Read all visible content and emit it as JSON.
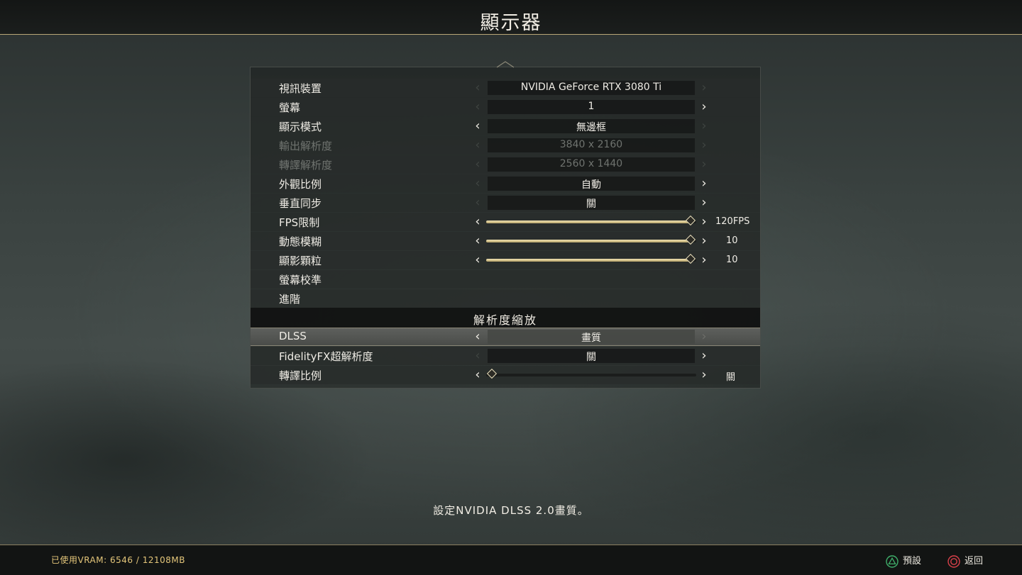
{
  "header": {
    "title": "顯示器"
  },
  "settings": {
    "video_device": {
      "label": "視訊裝置",
      "value": "NVIDIA GeForce RTX 3080 Ti"
    },
    "monitor": {
      "label": "螢幕",
      "value": "1"
    },
    "display_mode": {
      "label": "顯示模式",
      "value": "無邊框"
    },
    "output_resolution": {
      "label": "輸出解析度",
      "value": "3840 x 2160"
    },
    "render_resolution": {
      "label": "轉譯解析度",
      "value": "2560 x 1440"
    },
    "aspect_ratio": {
      "label": "外觀比例",
      "value": "自動"
    },
    "vsync": {
      "label": "垂直同步",
      "value": "關"
    },
    "fps_limit": {
      "label": "FPS限制",
      "display": "120FPS",
      "level": 1.0
    },
    "motion_blur": {
      "label": "動態模糊",
      "display": "10",
      "level": 1.0
    },
    "film_grain": {
      "label": "顯影顆粒",
      "display": "10",
      "level": 1.0
    },
    "calibration": {
      "label": "螢幕校準"
    },
    "advanced": {
      "label": "進階"
    }
  },
  "resolution_scaling": {
    "header": "解析度縮放",
    "dlss": {
      "label": "DLSS",
      "value": "畫質"
    },
    "fsr": {
      "label": "FidelityFX超解析度",
      "value": "關"
    },
    "render_scale": {
      "label": "轉譯比例",
      "display": "關",
      "level": 0.0
    }
  },
  "description": "設定NVIDIA DLSS 2.0畫質。",
  "footer": {
    "vram": "已使用VRAM: 6546 / 12108MB",
    "defaults_label": "預設",
    "back_label": "返回",
    "defaults_icon": "triangle-icon",
    "back_icon": "circle-icon",
    "triangle_color": "#3fae6a",
    "circle_color": "#d8404a"
  },
  "colors": {
    "accent": "#e4c67a",
    "slider": "#e6d7a2"
  }
}
